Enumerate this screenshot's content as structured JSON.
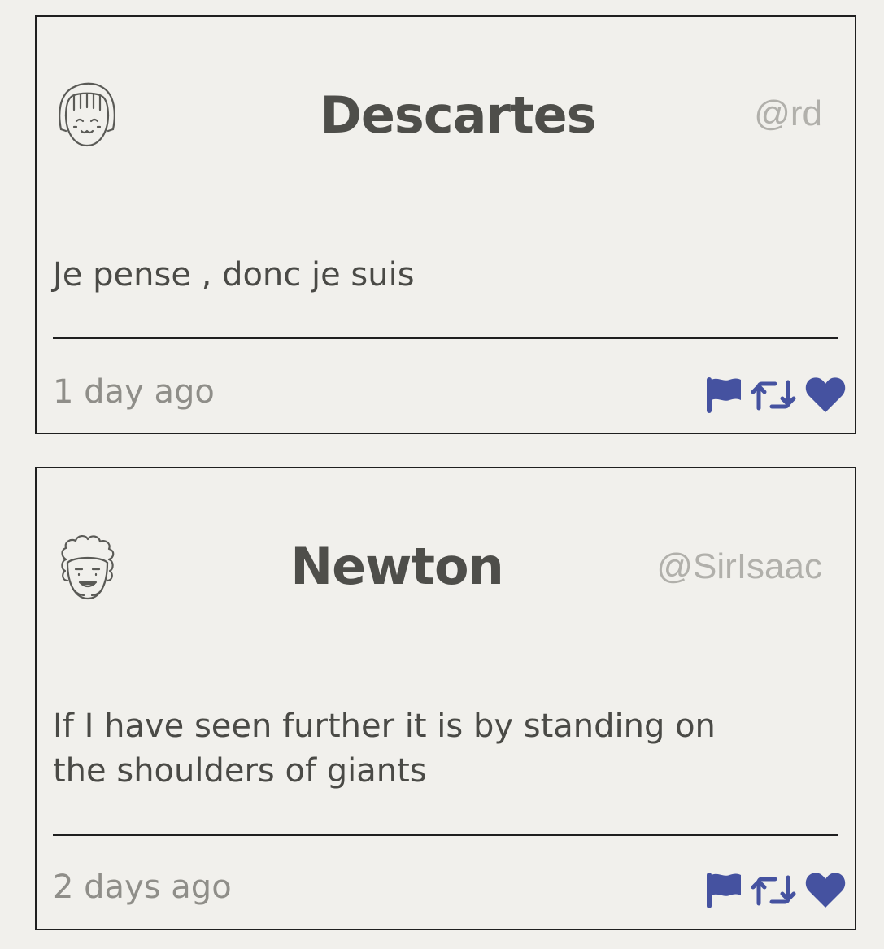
{
  "tweets": [
    {
      "author": "Descartes",
      "handle": "@rd",
      "message": "Je pense , donc je suis",
      "time": "1 day ago",
      "avatar_icon": "girl-face-icon"
    },
    {
      "author": "Newton",
      "handle": "@SirIsaac",
      "message": "If I have seen further it is by standing on the shoulders of giants",
      "time": "2 days ago",
      "avatar_icon": "curly-hair-face-icon"
    }
  ],
  "actions": {
    "flag_icon": "flag-icon",
    "retweet_icon": "retweet-icon",
    "like_icon": "heart-icon"
  },
  "colors": {
    "background": "#f1f0ec",
    "action_blue": "#4552a0",
    "name": "#4e4e4a",
    "handle": "#b1b0ab",
    "timestamp": "#8f8e89",
    "border": "#1f1f1f"
  }
}
